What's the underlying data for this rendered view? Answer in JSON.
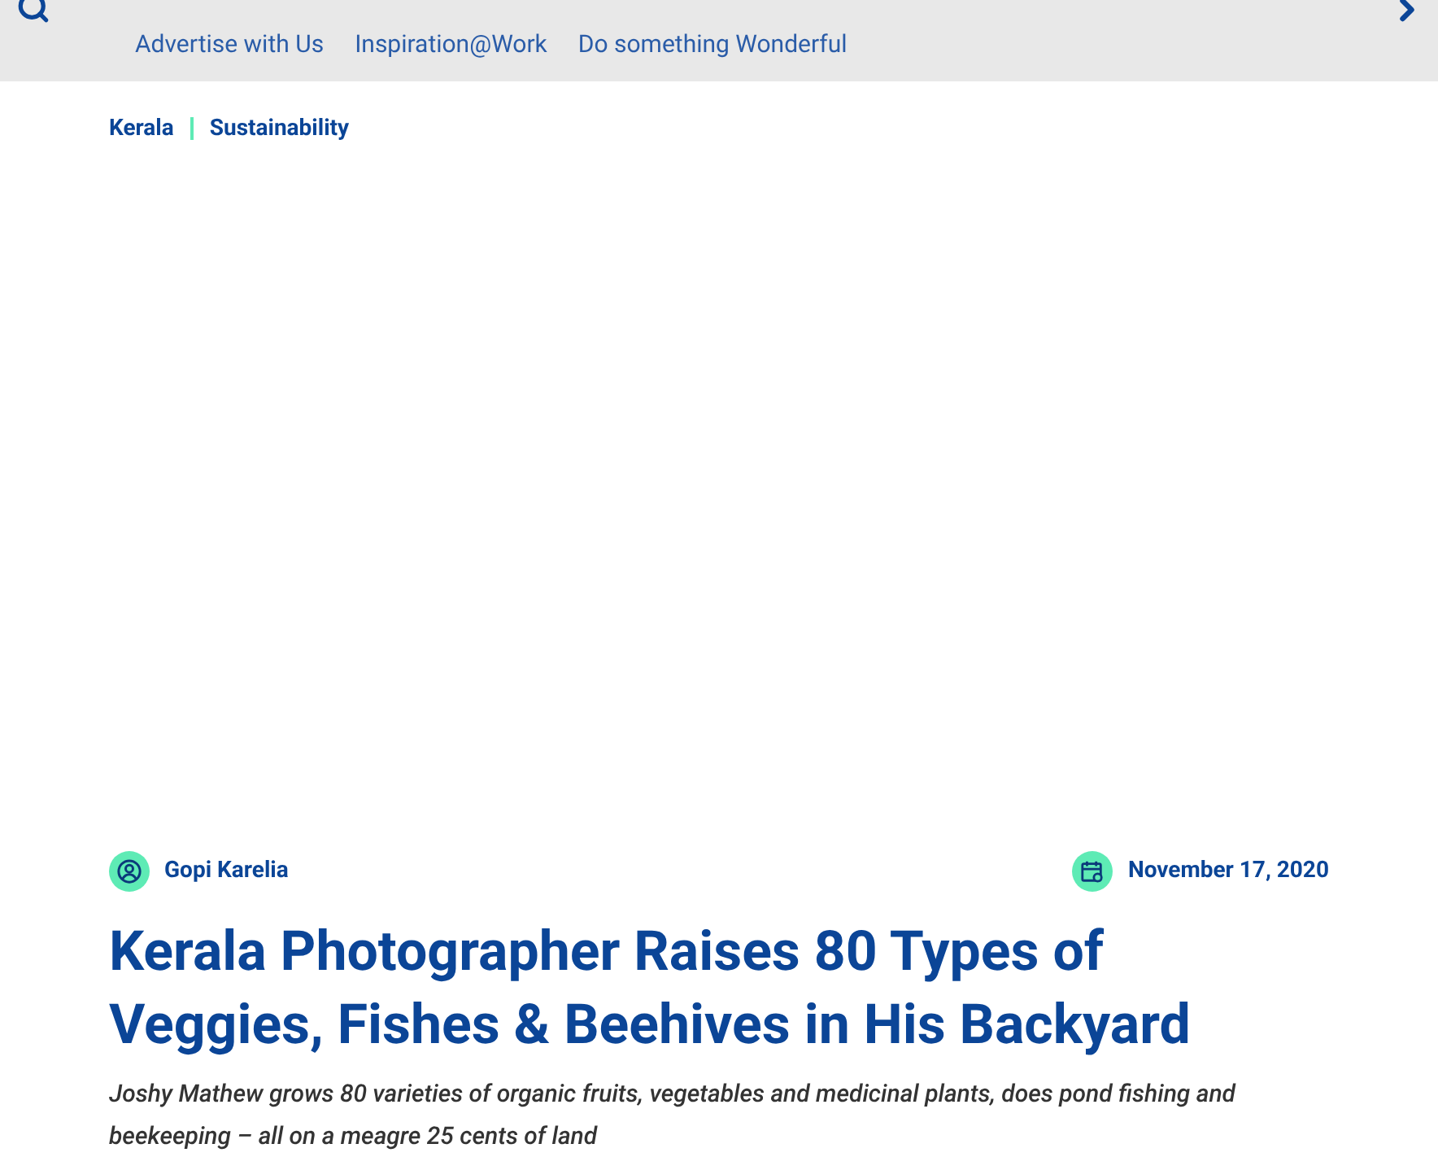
{
  "nav": {
    "links": [
      "Advertise with Us",
      "Inspiration@Work",
      "Do something Wonderful"
    ]
  },
  "breadcrumb": [
    "Kerala",
    "Sustainability"
  ],
  "article": {
    "author": "Gopi Karelia",
    "date": "November 17, 2020",
    "title": "Kerala Photographer Raises 80 Types of Veggies, Fishes & Beehives in His Backyard",
    "subtitle": "Joshy Mathew grows 80 varieties of organic fruits, vegetables and medicinal plants, does pond fishing and beekeeping – all on a meagre 25 cents of land"
  }
}
